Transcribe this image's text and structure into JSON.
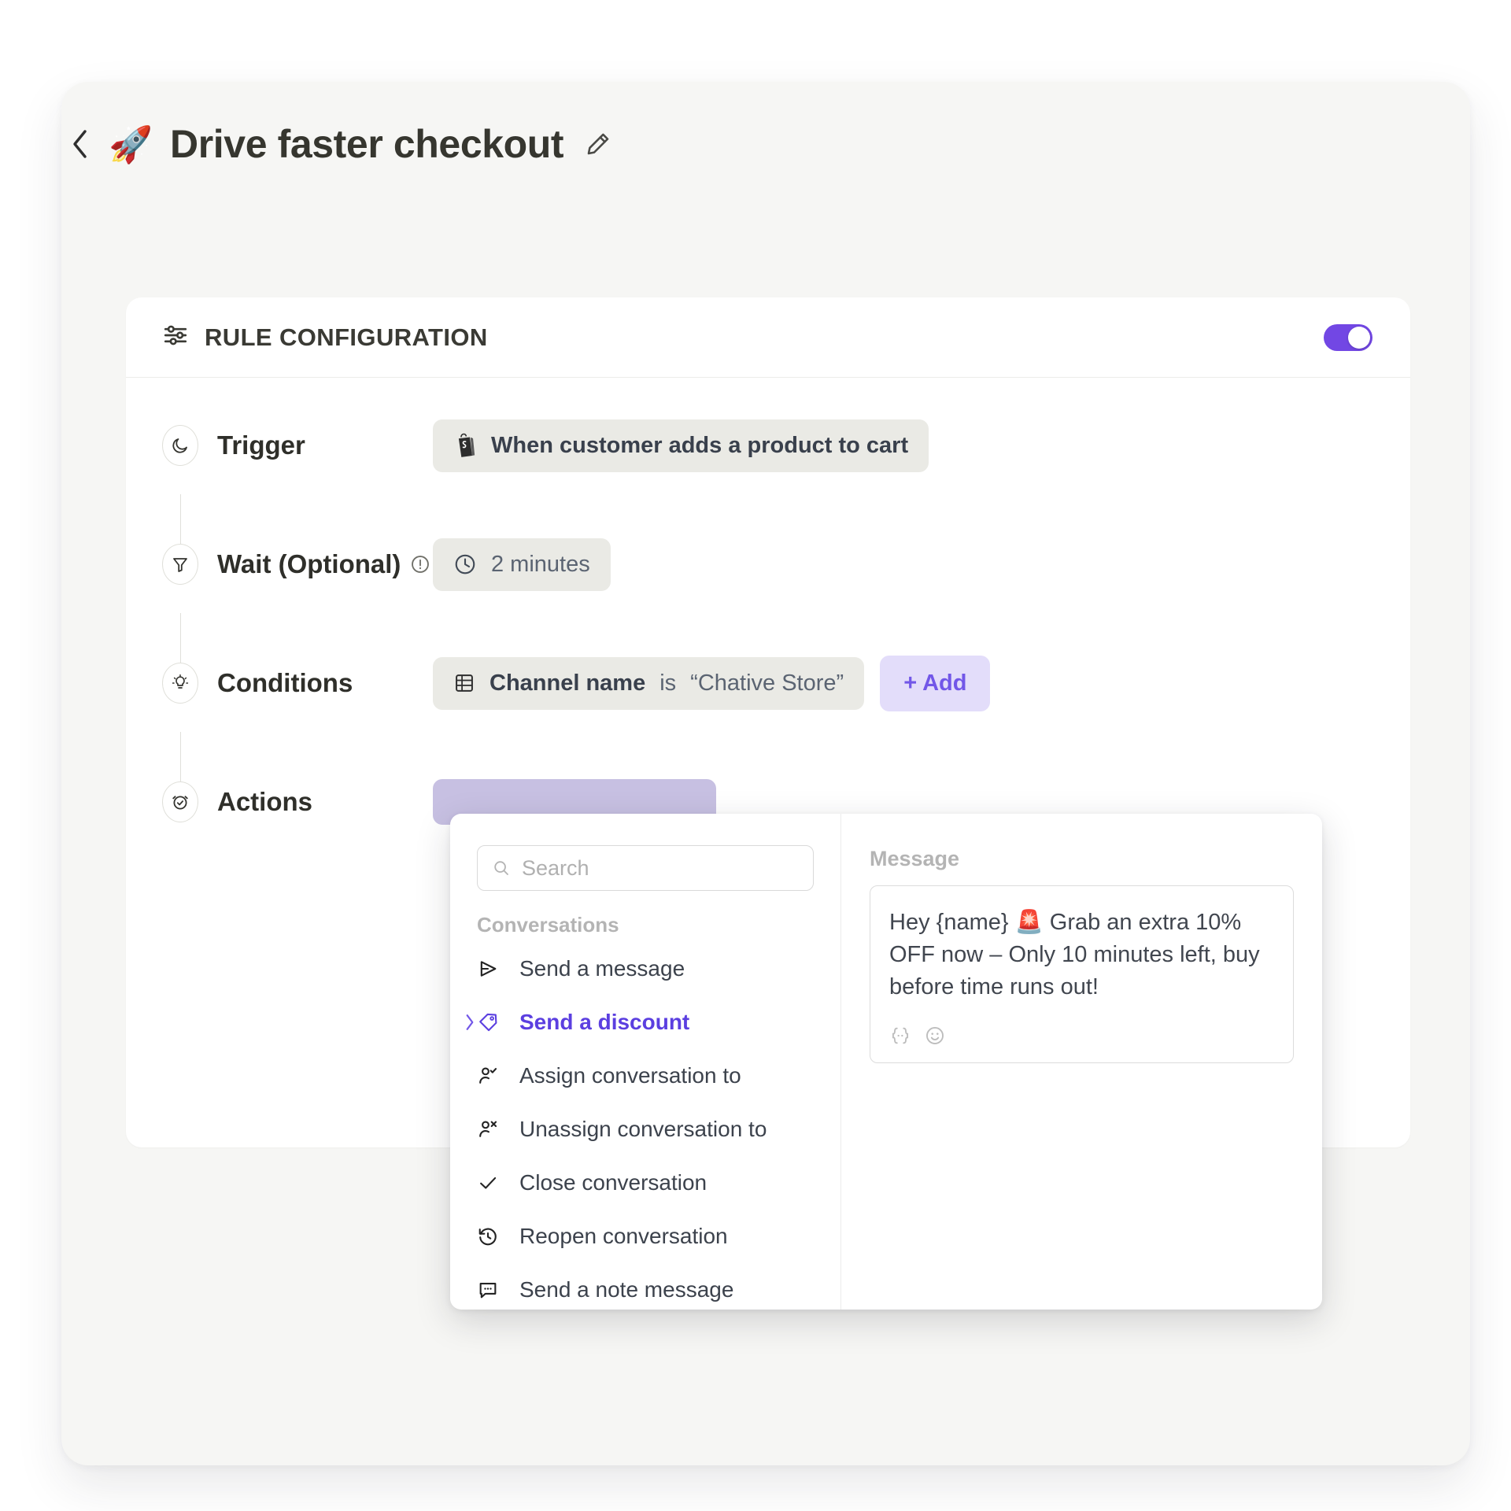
{
  "header": {
    "back_icon": "chevron-left-icon",
    "emoji": "🚀",
    "title": "Drive faster checkout",
    "edit_icon": "pencil-icon"
  },
  "card": {
    "icon": "sliders-icon",
    "title": "RULE CONFIGURATION",
    "toggle_on": true,
    "accent_color": "#7247e4"
  },
  "steps": {
    "trigger": {
      "label": "Trigger",
      "bullet_icon": "moon-icon",
      "chip": {
        "icon": "shopify-bag-icon",
        "text": "When customer adds a product to cart"
      }
    },
    "wait": {
      "label": "Wait (Optional)",
      "bullet_icon": "funnel-icon",
      "info_icon": "info-circle-icon",
      "chip": {
        "icon": "clock-icon",
        "text": "2 minutes"
      }
    },
    "conditions": {
      "label": "Conditions",
      "bullet_icon": "lightbulb-icon",
      "chip": {
        "icon": "table-icon",
        "field": "Channel name",
        "operator": "is",
        "value": "“Chative Store”"
      },
      "add_label": "+ Add"
    },
    "actions": {
      "label": "Actions",
      "bullet_icon": "alarm-check-icon"
    }
  },
  "popover": {
    "search": {
      "placeholder": "Search",
      "value": "",
      "icon": "search-icon"
    },
    "group_label": "Conversations",
    "items": [
      {
        "label": "Send a message",
        "icon": "send-icon",
        "active": false,
        "expandable": false
      },
      {
        "label": "Send a discount",
        "icon": "tag-icon",
        "active": true,
        "expandable": true
      },
      {
        "label": "Assign conversation to",
        "icon": "user-check-icon",
        "active": false,
        "expandable": false
      },
      {
        "label": "Unassign conversation to",
        "icon": "user-x-icon",
        "active": false,
        "expandable": false
      },
      {
        "label": "Close conversation",
        "icon": "check-icon",
        "active": false,
        "expandable": false
      },
      {
        "label": "Reopen conversation",
        "icon": "history-icon",
        "active": false,
        "expandable": false
      },
      {
        "label": "Send a note message",
        "icon": "note-bubble-icon",
        "active": false,
        "expandable": false
      }
    ],
    "detail": {
      "field_label": "Message",
      "message_value": "Hey {name} 🚨 Grab an extra 10% OFF now – Only 10 minutes left, buy before time runs out!",
      "tools": [
        {
          "icon": "merge-tag-icon",
          "glyph": "{··}"
        },
        {
          "icon": "emoji-smiley-icon",
          "glyph": "☺"
        }
      ]
    }
  }
}
